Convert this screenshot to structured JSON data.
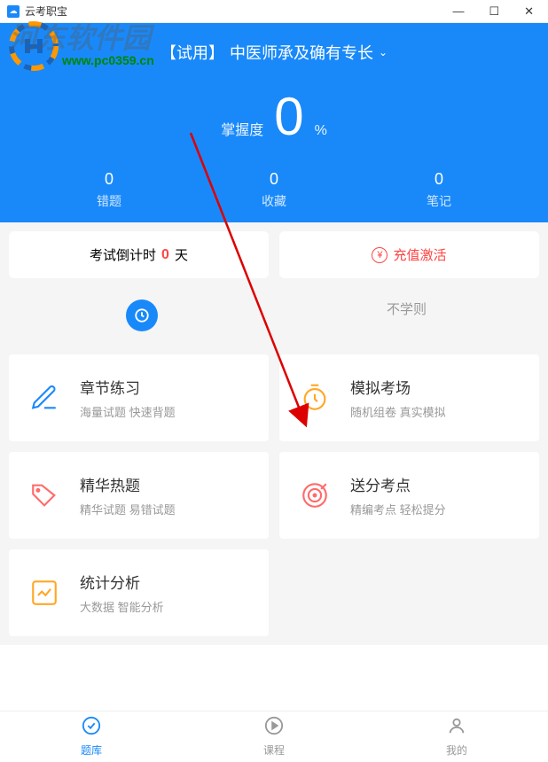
{
  "titlebar": {
    "title": "云考职宝"
  },
  "header": {
    "course_prefix": "【试用】",
    "course_name": "中医师承及确有专长"
  },
  "mastery": {
    "label": "掌握度",
    "value": "0",
    "unit": "%"
  },
  "stats": [
    {
      "value": "0",
      "label": "错题"
    },
    {
      "value": "0",
      "label": "收藏"
    },
    {
      "value": "0",
      "label": "笔记"
    }
  ],
  "actions": {
    "countdown_prefix": "考试倒计时",
    "countdown_value": "0",
    "countdown_suffix": "天",
    "recharge": "充值激活"
  },
  "tabs": {
    "inactive": "不学则"
  },
  "features": [
    {
      "title": "章节练习",
      "sub": "海量试题 快速背题"
    },
    {
      "title": "模拟考场",
      "sub": "随机组卷 真实模拟"
    },
    {
      "title": "精华热题",
      "sub": "精华试题 易错试题"
    },
    {
      "title": "送分考点",
      "sub": "精编考点 轻松提分"
    },
    {
      "title": "统计分析",
      "sub": "大数据 智能分析"
    }
  ],
  "nav": [
    {
      "label": "题库"
    },
    {
      "label": "课程"
    },
    {
      "label": "我的"
    }
  ],
  "watermark": {
    "text": "河东软件园",
    "url": "www.pc0359.cn"
  }
}
